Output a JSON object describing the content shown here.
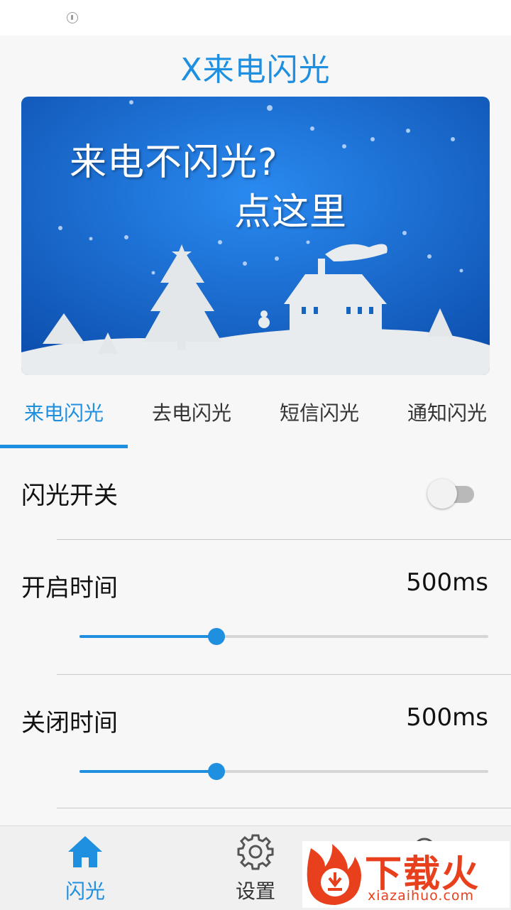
{
  "app": {
    "title": "X来电闪光"
  },
  "banner": {
    "line1": "来电不闪光?",
    "line2": "点这里"
  },
  "tabs": [
    {
      "label": "来电闪光",
      "active": true
    },
    {
      "label": "去电闪光",
      "active": false
    },
    {
      "label": "短信闪光",
      "active": false
    },
    {
      "label": "通知闪光",
      "active": false
    }
  ],
  "settings": {
    "flash_switch": {
      "label": "闪光开关",
      "on": false
    },
    "on_time": {
      "label": "开启时间",
      "value": "500ms",
      "slider_fraction": 0.335
    },
    "off_time": {
      "label": "关闭时间",
      "value": "500ms",
      "slider_fraction": 0.335
    }
  },
  "bottom_nav": [
    {
      "label": "闪光",
      "icon": "home-icon",
      "active": true
    },
    {
      "label": "设置",
      "icon": "gear-icon",
      "active": false
    },
    {
      "label": "",
      "icon": "search-icon",
      "active": false
    }
  ],
  "watermark": {
    "brand": "下载火",
    "site": "xiazaihuo.com"
  },
  "colors": {
    "accent": "#1f8fe0",
    "banner_blue": "#1565c0",
    "watermark": "#e8401d"
  }
}
